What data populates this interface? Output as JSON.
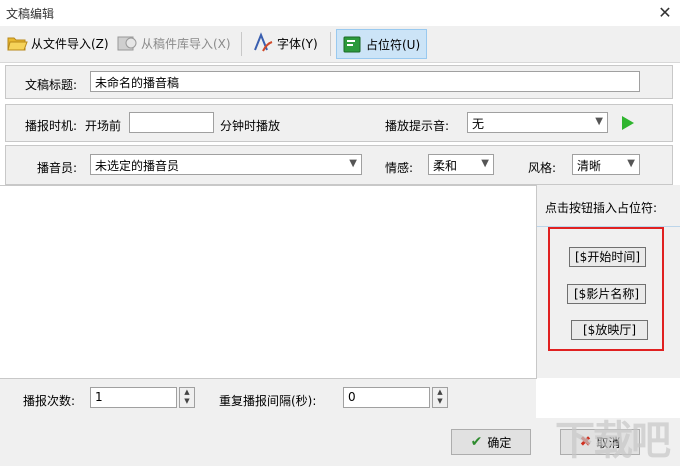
{
  "window": {
    "title": "文稿编辑",
    "close_glyph": "✕"
  },
  "toolbar": {
    "import_file": "从文件导入(Z)",
    "import_library": "从稿件库导入(X)",
    "font": "字体(Y)",
    "placeholder": "占位符(U)"
  },
  "form": {
    "title_label": "文稿标题:",
    "title_value": "未命名的播音稿",
    "time_label": "播报时机:",
    "before_label": "开场前",
    "time_value": "",
    "minutes_label": "分钟时播放",
    "sound_label": "播放提示音:",
    "sound_value": "无",
    "announcer_label": "播音员:",
    "announcer_value": "未选定的播音员",
    "emotion_label": "情感:",
    "emotion_value": "柔和",
    "style_label": "风格:",
    "style_value": "清晰"
  },
  "side": {
    "hint": "点击按钮插入占位符:",
    "buttons": [
      "[$开始时间]",
      "[$影片名称]",
      "[$放映厅]"
    ]
  },
  "bottom": {
    "count_label": "播报次数:",
    "count_value": "1",
    "interval_label": "重复播报间隔(秒):",
    "interval_value": "0"
  },
  "footer": {
    "ok": "确定",
    "cancel": "取消"
  },
  "watermark": "下载吧",
  "colors": {
    "highlight_border": "#e02020",
    "play": "#2fb52f",
    "ok_check": "#2e8b2e",
    "cancel_x": "#d03020"
  }
}
